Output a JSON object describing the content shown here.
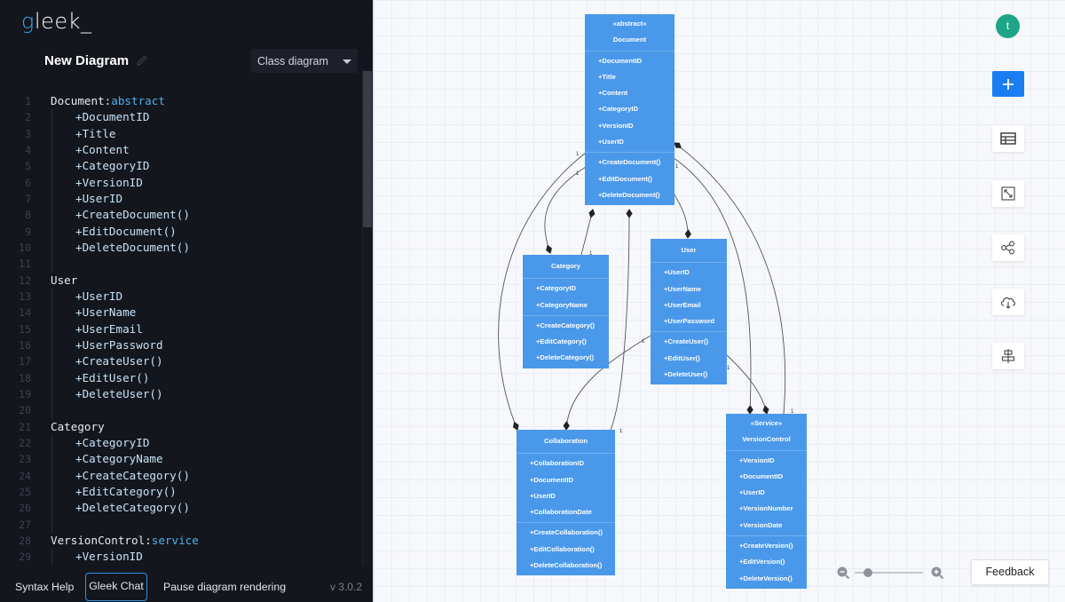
{
  "app": {
    "logo_first": "g",
    "logo_rest": "leek_",
    "diagram_title": "New Diagram",
    "diagram_type": "Class diagram",
    "version": "v 3.0.2"
  },
  "editor": {
    "lines": [
      {
        "n": "1",
        "parts": [
          {
            "t": "Document:",
            "k": false
          },
          {
            "t": "abstract",
            "k": true
          }
        ],
        "indent": false
      },
      {
        "n": "2",
        "parts": [
          {
            "t": "+DocumentID",
            "k": false
          }
        ],
        "indent": true
      },
      {
        "n": "3",
        "parts": [
          {
            "t": "+Title",
            "k": false
          }
        ],
        "indent": true
      },
      {
        "n": "4",
        "parts": [
          {
            "t": "+Content",
            "k": false
          }
        ],
        "indent": true
      },
      {
        "n": "5",
        "parts": [
          {
            "t": "+CategoryID",
            "k": false
          }
        ],
        "indent": true
      },
      {
        "n": "6",
        "parts": [
          {
            "t": "+VersionID",
            "k": false
          }
        ],
        "indent": true
      },
      {
        "n": "7",
        "parts": [
          {
            "t": "+UserID",
            "k": false
          }
        ],
        "indent": true
      },
      {
        "n": "8",
        "parts": [
          {
            "t": "+CreateDocument()",
            "k": false
          }
        ],
        "indent": true
      },
      {
        "n": "9",
        "parts": [
          {
            "t": "+EditDocument()",
            "k": false
          }
        ],
        "indent": true
      },
      {
        "n": "10",
        "parts": [
          {
            "t": "+DeleteDocument()",
            "k": false
          }
        ],
        "indent": true
      },
      {
        "n": "11",
        "parts": [],
        "indent": false,
        "guide": true
      },
      {
        "n": "12",
        "parts": [
          {
            "t": "User",
            "k": false
          }
        ],
        "indent": false
      },
      {
        "n": "13",
        "parts": [
          {
            "t": "+UserID",
            "k": false
          }
        ],
        "indent": true
      },
      {
        "n": "14",
        "parts": [
          {
            "t": "+UserName",
            "k": false
          }
        ],
        "indent": true
      },
      {
        "n": "15",
        "parts": [
          {
            "t": "+UserEmail",
            "k": false
          }
        ],
        "indent": true
      },
      {
        "n": "16",
        "parts": [
          {
            "t": "+UserPassword",
            "k": false
          }
        ],
        "indent": true
      },
      {
        "n": "17",
        "parts": [
          {
            "t": "+CreateUser()",
            "k": false
          }
        ],
        "indent": true
      },
      {
        "n": "18",
        "parts": [
          {
            "t": "+EditUser()",
            "k": false
          }
        ],
        "indent": true
      },
      {
        "n": "19",
        "parts": [
          {
            "t": "+DeleteUser()",
            "k": false
          }
        ],
        "indent": true
      },
      {
        "n": "20",
        "parts": [],
        "indent": false,
        "guide": true
      },
      {
        "n": "21",
        "parts": [
          {
            "t": "Category",
            "k": false
          }
        ],
        "indent": false
      },
      {
        "n": "22",
        "parts": [
          {
            "t": "+CategoryID",
            "k": false
          }
        ],
        "indent": true
      },
      {
        "n": "23",
        "parts": [
          {
            "t": "+CategoryName",
            "k": false
          }
        ],
        "indent": true
      },
      {
        "n": "24",
        "parts": [
          {
            "t": "+CreateCategory()",
            "k": false
          }
        ],
        "indent": true
      },
      {
        "n": "25",
        "parts": [
          {
            "t": "+EditCategory()",
            "k": false
          }
        ],
        "indent": true
      },
      {
        "n": "26",
        "parts": [
          {
            "t": "+DeleteCategory()",
            "k": false
          }
        ],
        "indent": true
      },
      {
        "n": "27",
        "parts": [],
        "indent": false,
        "guide": true
      },
      {
        "n": "28",
        "parts": [
          {
            "t": "VersionControl:",
            "k": false
          },
          {
            "t": "service",
            "k": true
          }
        ],
        "indent": false
      },
      {
        "n": "29",
        "parts": [
          {
            "t": "+VersionID",
            "k": false
          }
        ],
        "indent": true
      }
    ]
  },
  "bottom_bar": {
    "syntax_help": "Syntax Help",
    "gleek_chat": "Gleek Chat",
    "pause_rendering": "Pause diagram rendering"
  },
  "diagram": {
    "classes": {
      "document": {
        "stereotype": "«abstract»",
        "name": "Document",
        "attributes": [
          "+DocumentID",
          "+Title",
          "+Content",
          "+CategoryID",
          "+VersionID",
          "+UserID"
        ],
        "methods": [
          "+CreateDocument()",
          "+EditDocument()",
          "+DeleteDocument()"
        ]
      },
      "category": {
        "name": "Category",
        "attributes": [
          "+CategoryID",
          "+CategoryName"
        ],
        "methods": [
          "+CreateCategory()",
          "+EditCategory()",
          "+DeleteCategory()"
        ]
      },
      "user": {
        "name": "User",
        "attributes": [
          "+UserID",
          "+UserName",
          "+UserEmail",
          "+UserPassword"
        ],
        "methods": [
          "+CreateUser()",
          "+EditUser()",
          "+DeleteUser()"
        ]
      },
      "collaboration": {
        "name": "Collaboration",
        "attributes": [
          "+CollaborationID",
          "+DocumentID",
          "+UserID",
          "+CollaborationDate"
        ],
        "methods": [
          "+CreateCollaboration()",
          "+EditCollaboration()",
          "+DeleteCollaboration()"
        ]
      },
      "versioncontrol": {
        "stereotype": "«Service»",
        "name": "VersionControl",
        "attributes": [
          "+VersionID",
          "+DocumentID",
          "+UserID",
          "+VersionNumber",
          "+VersionDate"
        ],
        "methods": [
          "+CreateVersion()",
          "+EditVersion()",
          "+DeleteVersion()"
        ]
      }
    },
    "multiplicity_label": "1"
  },
  "toolbar": {
    "avatar_initial": "t",
    "add_icon": "plus-icon",
    "table_icon": "table-icon",
    "fit_icon": "expand-icon",
    "share_icon": "share-icon",
    "download_icon": "cloud-download-icon",
    "align_icon": "align-center-icon"
  },
  "zoom": {
    "level_fraction": 0.2
  },
  "feedback_label": "Feedback",
  "colors": {
    "class_fill": "#4a98ea",
    "accent": "#1a7ef0",
    "avatar": "#1ea587",
    "keyword": "#4fb0e6"
  }
}
